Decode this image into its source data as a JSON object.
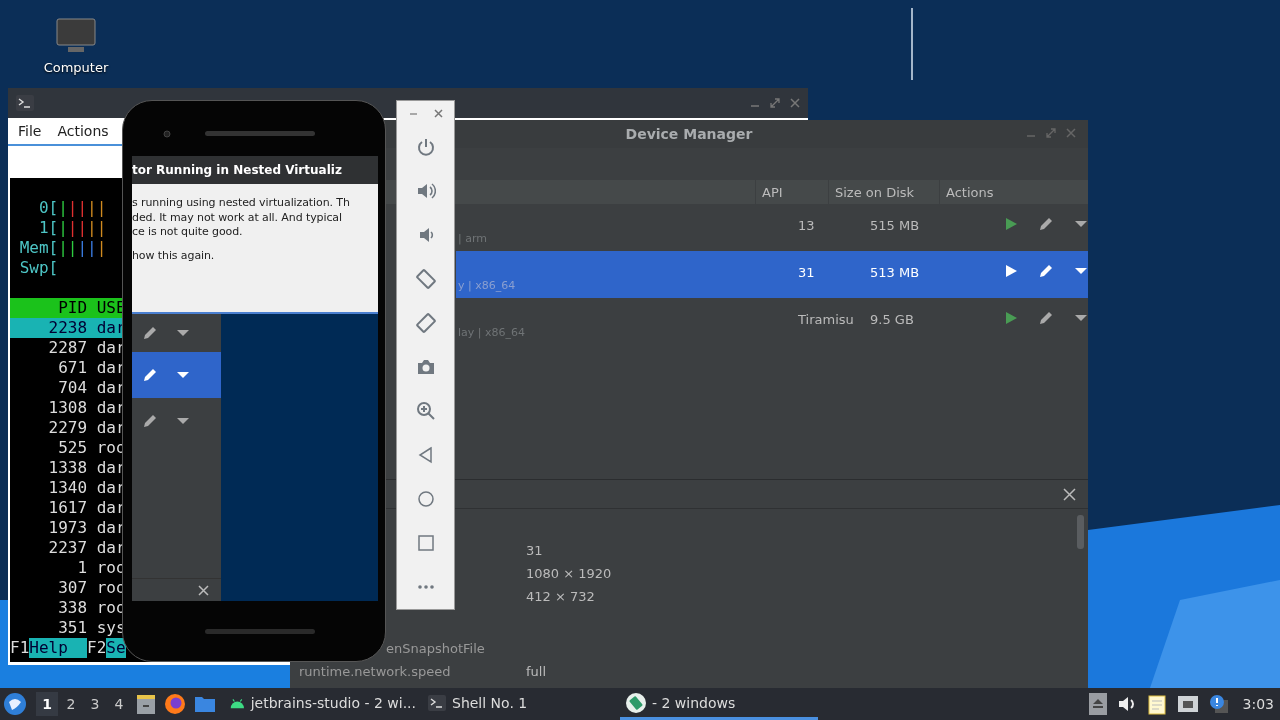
{
  "desktop": {
    "icons": [
      {
        "label": "Computer"
      }
    ]
  },
  "shell_window": {
    "menu": [
      "File",
      "Actions"
    ],
    "htop": {
      "meters": [
        {
          "label": "0[",
          "bars": "|||||"
        },
        {
          "label": "1[",
          "bars": "|||||"
        },
        {
          "label": "Mem[",
          "bars": "|||||"
        },
        {
          "label": "Swp["
        }
      ],
      "header": {
        "pid": "PID",
        "user": "USE"
      },
      "processes": [
        {
          "pid": "2238",
          "user": "dar",
          "selected": true
        },
        {
          "pid": "2287",
          "user": "dar",
          "selected": false
        },
        {
          "pid": "671",
          "user": "dar",
          "selected": false
        },
        {
          "pid": "704",
          "user": "dar",
          "selected": false
        },
        {
          "pid": "1308",
          "user": "dar",
          "selected": false
        },
        {
          "pid": "2279",
          "user": "dar",
          "selected": false
        },
        {
          "pid": "525",
          "user": "roo",
          "selected": false
        },
        {
          "pid": "1338",
          "user": "dar",
          "selected": false
        },
        {
          "pid": "1340",
          "user": "dar",
          "selected": false
        },
        {
          "pid": "1617",
          "user": "dar",
          "selected": false
        },
        {
          "pid": "1973",
          "user": "dar",
          "selected": false
        },
        {
          "pid": "2237",
          "user": "dar",
          "selected": false
        },
        {
          "pid": "1",
          "user": "roo",
          "selected": false
        },
        {
          "pid": "307",
          "user": "roo",
          "selected": false
        },
        {
          "pid": "338",
          "user": "roo",
          "selected": false
        },
        {
          "pid": "351",
          "user": "sys",
          "selected": false
        }
      ],
      "function_keys": [
        {
          "key": "F1",
          "label": "Help  "
        },
        {
          "key": "F2",
          "label": "Se"
        }
      ]
    }
  },
  "device_manager": {
    "title": "Device Manager",
    "columns": [
      "API",
      "Size on Disk",
      "Actions"
    ],
    "rows": [
      {
        "details": "| arm",
        "api": "13",
        "size": "515 MB",
        "selected": false
      },
      {
        "details": "y | x86_64",
        "api": "31",
        "size": "513 MB",
        "selected": true
      },
      {
        "details": "lay | x86_64",
        "api": "Tiramisu",
        "size": "9.5 GB",
        "selected": false
      }
    ],
    "detail_groups": [
      {
        "rows": [
          {
            "value": "31"
          },
          {
            "value": "1080 × 1920"
          },
          {
            "value": "412 × 732"
          }
        ]
      },
      {
        "rows": [
          {
            "key": "enSnapshotFile",
            "truncated": true
          },
          {
            "key": "runtime.network.speed",
            "value": "full",
            "truncated": false
          }
        ]
      }
    ]
  },
  "emulator": {
    "dialog": {
      "title": "tor Running in Nested Virtualiz",
      "lines": [
        "s running using nested virtualization. Th",
        "ded. It may not work at all. And typical",
        "ce is not quite good."
      ],
      "checkbox_label": "how this again."
    },
    "mini_rows": [
      {
        "selected": false
      },
      {
        "selected": true
      },
      {
        "selected": false
      }
    ]
  },
  "taskbar": {
    "workspaces": [
      {
        "label": "1",
        "selected": true
      },
      {
        "label": "2",
        "selected": false
      },
      {
        "label": "3",
        "selected": false
      },
      {
        "label": "4",
        "selected": false
      }
    ],
    "tasks": [
      {
        "label": "jetbrains-studio - 2 wi...",
        "selected": false
      },
      {
        "label": "Shell No. 1",
        "selected": false
      },
      {
        "label": "- 2 windows",
        "selected": true
      }
    ],
    "clock": "3:03"
  }
}
